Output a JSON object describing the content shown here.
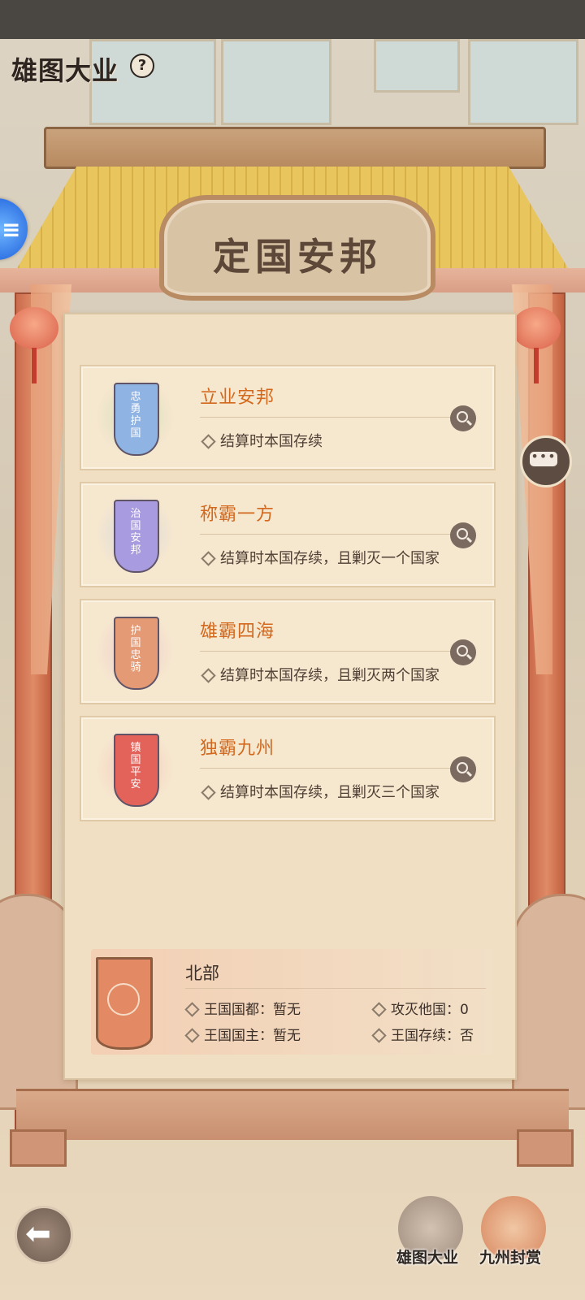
{
  "header": {
    "title": "雄图大业",
    "help_glyph": "?"
  },
  "gate": {
    "plaque": "定国安邦"
  },
  "goals": [
    {
      "title": "立业安邦",
      "desc": "结算时本国存续",
      "banner_text": "忠勇护国",
      "banner_color": "#8fb3e3",
      "glow_color": "#a7d3a0",
      "icon": "search-icon"
    },
    {
      "title": "称霸一方",
      "desc": "结算时本国存续，且剿灭一个国家",
      "banner_text": "治国安邦",
      "banner_color": "#a99be0",
      "glow_color": "#b5c8e8",
      "icon": "search-icon"
    },
    {
      "title": "雄霸四海",
      "desc": "结算时本国存续，且剿灭两个国家",
      "banner_text": "护国忠骑",
      "banner_color": "#e49a74",
      "glow_color": "#e7a9c2",
      "icon": "search-icon"
    },
    {
      "title": "独霸九州",
      "desc": "结算时本国存续，且剿灭三个国家",
      "banner_text": "镇国平安",
      "banner_color": "#e3625a",
      "glow_color": "#f0a79c",
      "icon": "search-icon"
    }
  ],
  "region": {
    "name": "北部",
    "capital": "王国国都：暂无",
    "ruler": "王国国主：暂无",
    "conquered": "攻灭他国：0",
    "survived": "王国存续：否"
  },
  "footer": {
    "back_icon": "back-arrow-icon",
    "tab1": "雄图大业",
    "tab2": "九州封赏"
  },
  "colors": {
    "accent": "#d2691e",
    "panel": "#f1dfc3"
  }
}
